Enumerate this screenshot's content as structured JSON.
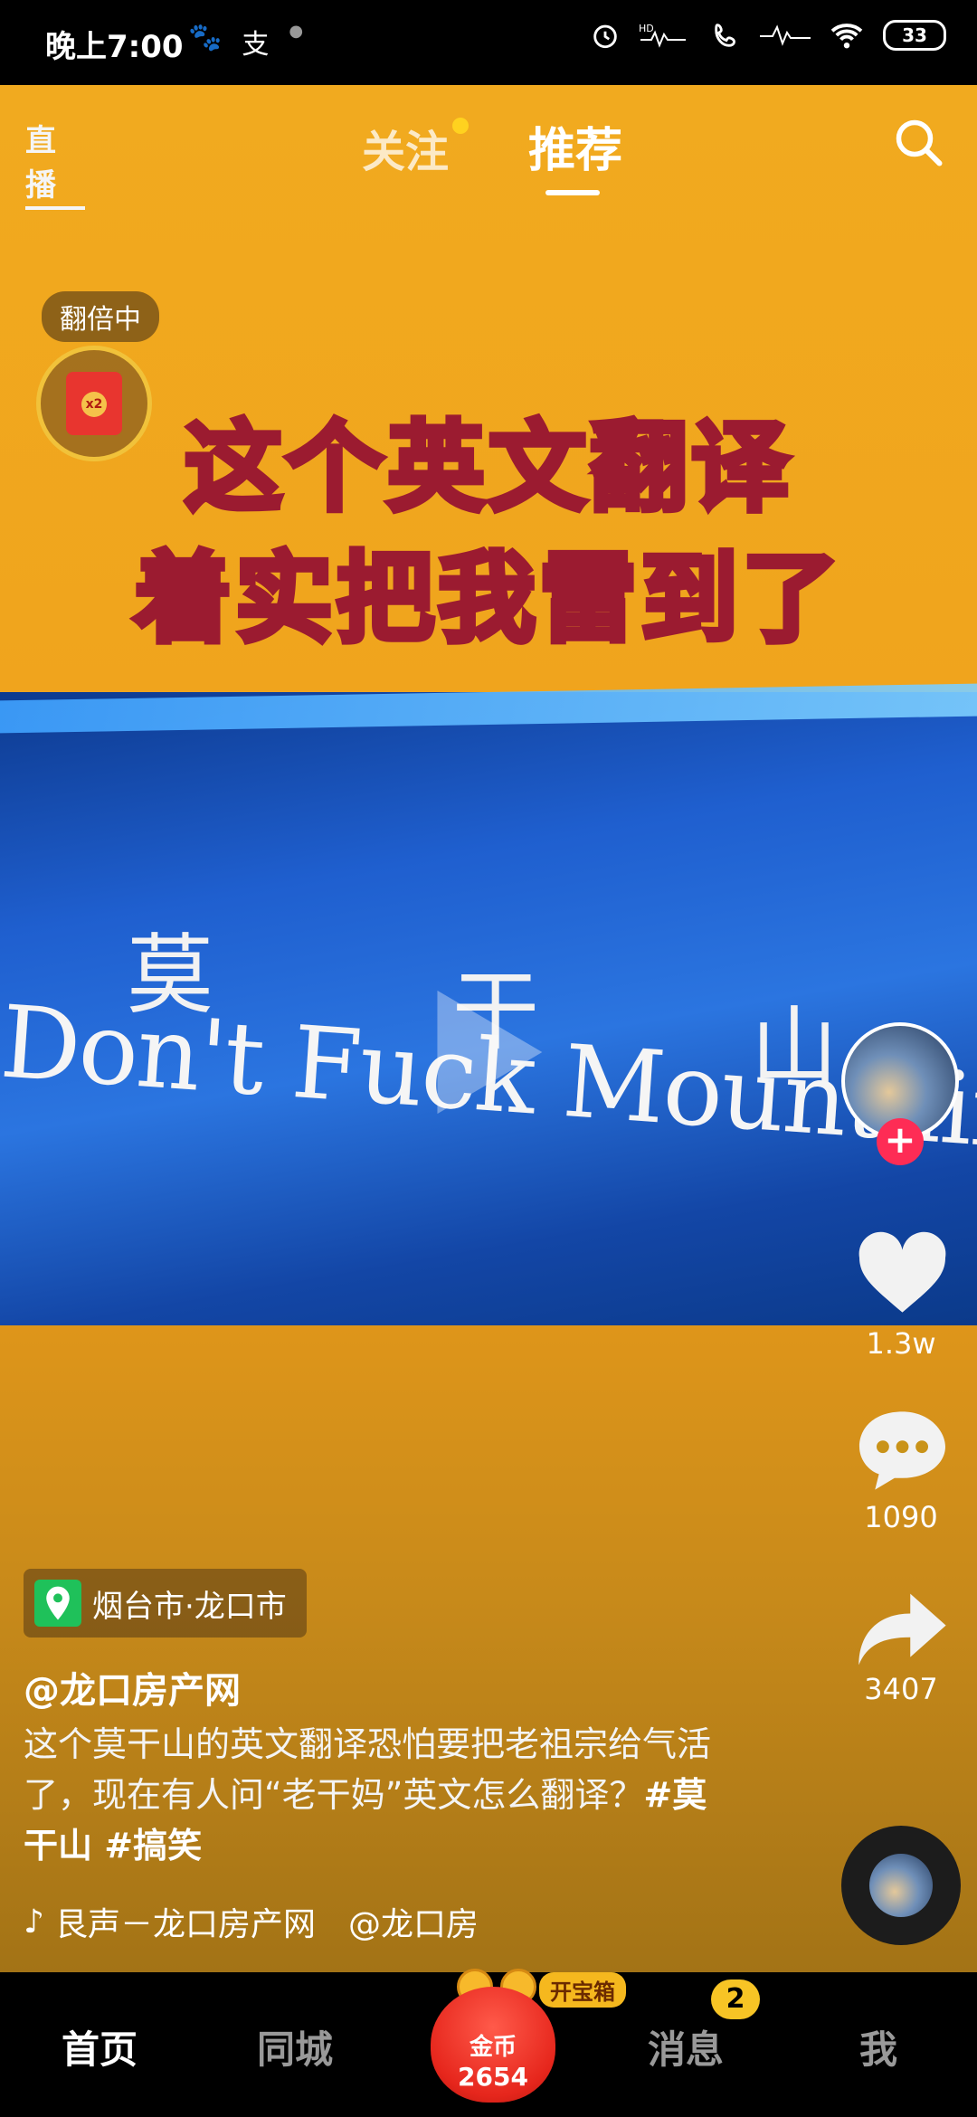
{
  "status_bar": {
    "time": "晚上7:00",
    "left_icons": [
      "baidu-icon",
      "alipay-icon",
      "dot-icon"
    ],
    "right_icons": [
      "alarm-icon",
      "hd-signal-icon",
      "call-icon",
      "signal-icon",
      "wifi-icon"
    ],
    "battery": "33"
  },
  "top_nav": {
    "live_label": "直播",
    "follow_tab": "关注",
    "recommend_tab": "推荐",
    "active_tab": "推荐"
  },
  "video": {
    "title_line1": "这个英文翻译",
    "title_line2": "着实把我雷到了",
    "sign_chars": [
      "莫",
      "干",
      "山"
    ],
    "sign_english": "Don't Fuck Mountain"
  },
  "reward": {
    "label": "翻倍中",
    "multiplier": "x2"
  },
  "side_actions": {
    "likes": "1.3w",
    "comments": "1090",
    "shares": "3407",
    "follow_symbol": "+"
  },
  "post": {
    "location": "烟台市·龙口市",
    "author": "@龙口房产网",
    "caption_text": "这个莫干山的英文翻译恐怕要把老祖宗给气活了，现在有人问“老干妈”英文怎么翻译？",
    "caption_tags": "#莫干山 #搞笑",
    "music": "艮声－龙口房产网　@龙口房"
  },
  "bottom_nav": {
    "home": "首页",
    "local": "同城",
    "coins_label": "金币",
    "coins_value": "2654",
    "treasure": "开宝箱",
    "messages": "消息",
    "messages_badge": "2",
    "me": "我"
  },
  "colors": {
    "accent_follow": "#fe2c55",
    "video_bg": "#f1aa1f",
    "badge": "#f7c425"
  }
}
